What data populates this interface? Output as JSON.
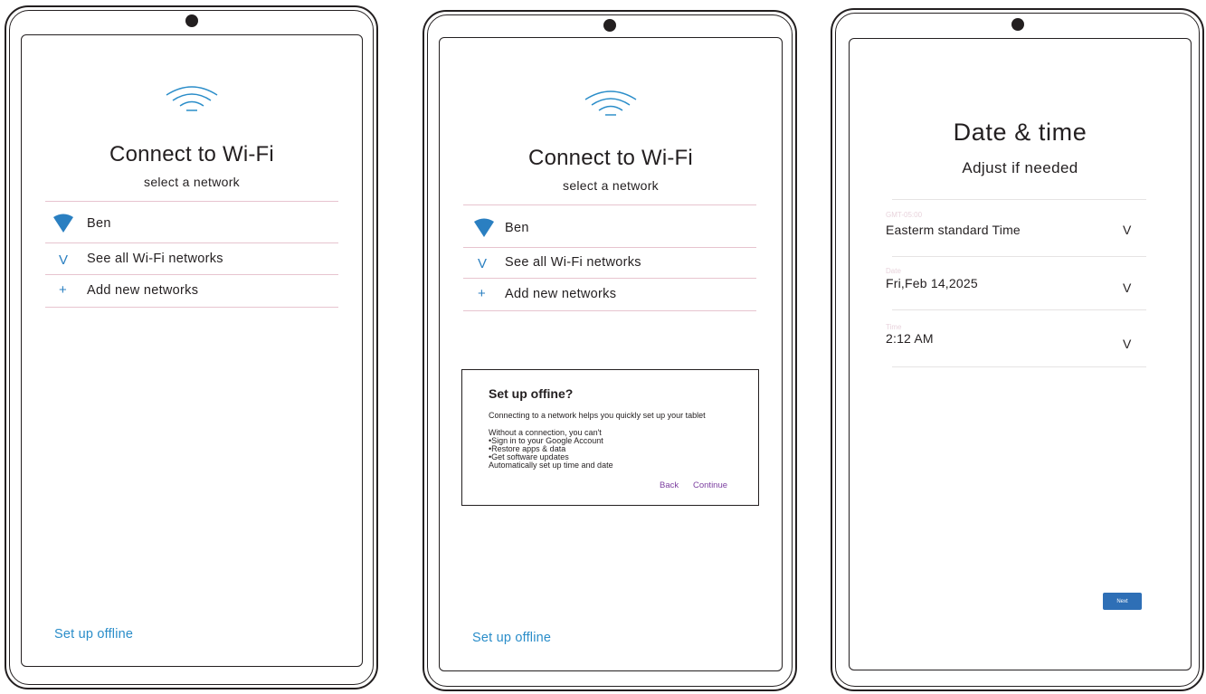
{
  "screens": [
    {
      "title": "Connect to Wi-Fi",
      "subtitle": "select a network",
      "networks": {
        "current": "Ben",
        "see_all": "See all Wi-Fi networks",
        "add_new": "Add new networks"
      },
      "icons": {
        "see_all": "V",
        "add_new": "+"
      },
      "offline_link": "Set up offline"
    },
    {
      "title": "Connect to Wi-Fi",
      "subtitle": "select a network",
      "networks": {
        "current": "Ben",
        "see_all": "See all Wi-Fi networks",
        "add_new": "Add new networks"
      },
      "icons": {
        "see_all": "V",
        "add_new": "+"
      },
      "offline_link": "Set up offline",
      "dialog": {
        "title": "Set up offine?",
        "intro": "Connecting to a network helps you quickly set up your tablet",
        "lines": [
          "Without a connection, you can't",
          "•Sign in to your Google Account",
          "•Restore apps & data",
          "•Get software updates",
          "Automatically set up time and date"
        ],
        "back": "Back",
        "continue": "Continue"
      }
    },
    {
      "title": "Date & time",
      "subtitle": "Adjust if needed",
      "fields": [
        {
          "label": "GMT-05:00",
          "value": "Easterm standard Time",
          "chevron": "V"
        },
        {
          "label": "Date",
          "value": "Fri,Feb 14,2025",
          "chevron": "V"
        },
        {
          "label": "Time",
          "value": "2:12 AM",
          "chevron": "V"
        }
      ],
      "next": "Next"
    }
  ],
  "colors": {
    "accent_blue": "#2a8dc9",
    "wifi_icon": "#2a7fc1",
    "dialog_button": "#7c3fa0",
    "next_button": "#2e6fb6",
    "divider": "#e7c4cf"
  }
}
